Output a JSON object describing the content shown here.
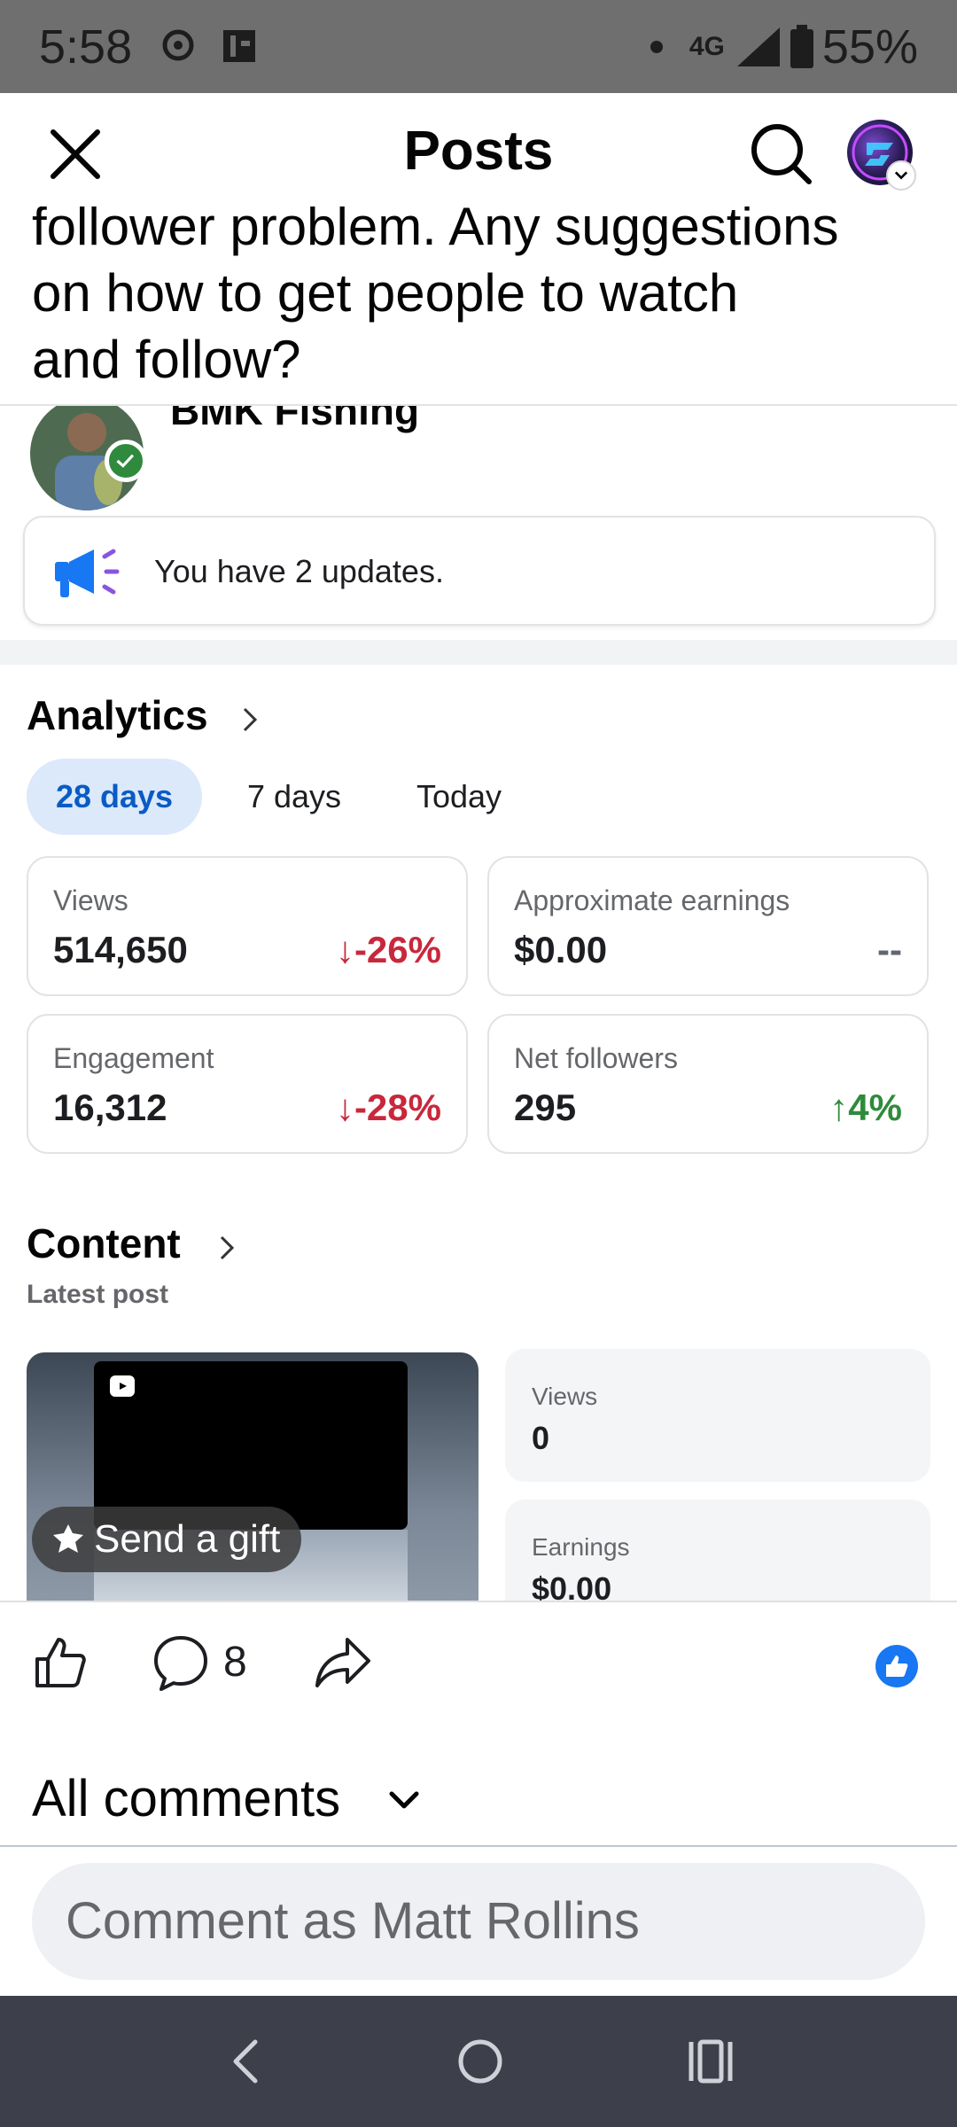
{
  "status_bar": {
    "time": "5:58",
    "network": "4G",
    "battery": "55%"
  },
  "header": {
    "title": "Posts"
  },
  "post": {
    "text_line1": "follower problem. Any suggestions",
    "text_line2": "on how to get people to watch",
    "text_line3": "and follow?"
  },
  "embedded": {
    "author_name": "BMK Fishing",
    "updates_text": "You have 2 updates.",
    "analytics_title": "Analytics",
    "tabs": [
      {
        "label": "28 days",
        "active": true
      },
      {
        "label": "7 days",
        "active": false
      },
      {
        "label": "Today",
        "active": false
      }
    ],
    "stats": [
      {
        "label": "Views",
        "value": "514,650",
        "delta": "-26%",
        "trend": "down"
      },
      {
        "label": "Approximate earnings",
        "value": "$0.00",
        "delta": "--",
        "trend": "none"
      },
      {
        "label": "Engagement",
        "value": "16,312",
        "delta": "-28%",
        "trend": "down"
      },
      {
        "label": "Net followers",
        "value": "295",
        "delta": "4%",
        "trend": "up"
      }
    ],
    "content_title": "Content",
    "content_subtitle": "Latest post",
    "gift_label": "Send a gift",
    "latest_stats": [
      {
        "label": "Views",
        "value": "0"
      },
      {
        "label": "Earnings",
        "value": "$0.00"
      }
    ]
  },
  "actions": {
    "comment_count": "8"
  },
  "comments": {
    "heading": "All comments",
    "input_placeholder": "Comment as Matt Rollins"
  },
  "colors": {
    "negative": "#c8283c",
    "positive": "#2e8b3a",
    "accent": "#0a5bc4",
    "facebook_blue": "#1877f2"
  }
}
